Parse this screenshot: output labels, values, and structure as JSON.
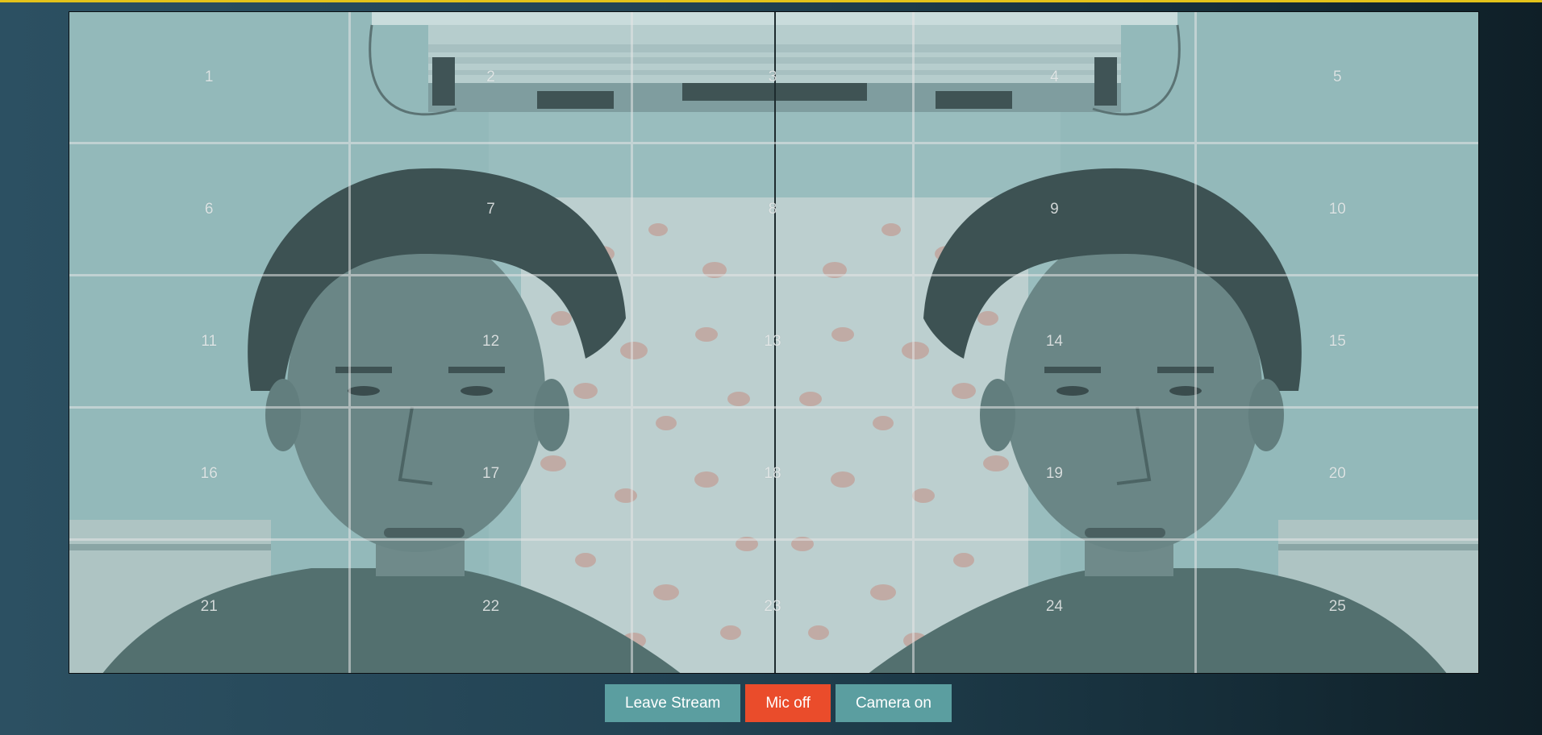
{
  "grid": {
    "cells": [
      "1",
      "2",
      "3",
      "4",
      "5",
      "6",
      "7",
      "8",
      "9",
      "10",
      "11",
      "12",
      "13",
      "14",
      "15",
      "16",
      "17",
      "18",
      "19",
      "20",
      "21",
      "22",
      "23",
      "24",
      "25"
    ]
  },
  "controls": {
    "leave_label": "Leave Stream",
    "mic_label": "Mic off",
    "camera_label": "Camera on"
  },
  "colors": {
    "accent_bar": "#e3c21a",
    "teal_button": "#5b9ea0",
    "mic_off_button": "#ea4c2b",
    "video_tint": "#8fb3b5"
  },
  "icons": {
    "video": "webcam-feed"
  }
}
